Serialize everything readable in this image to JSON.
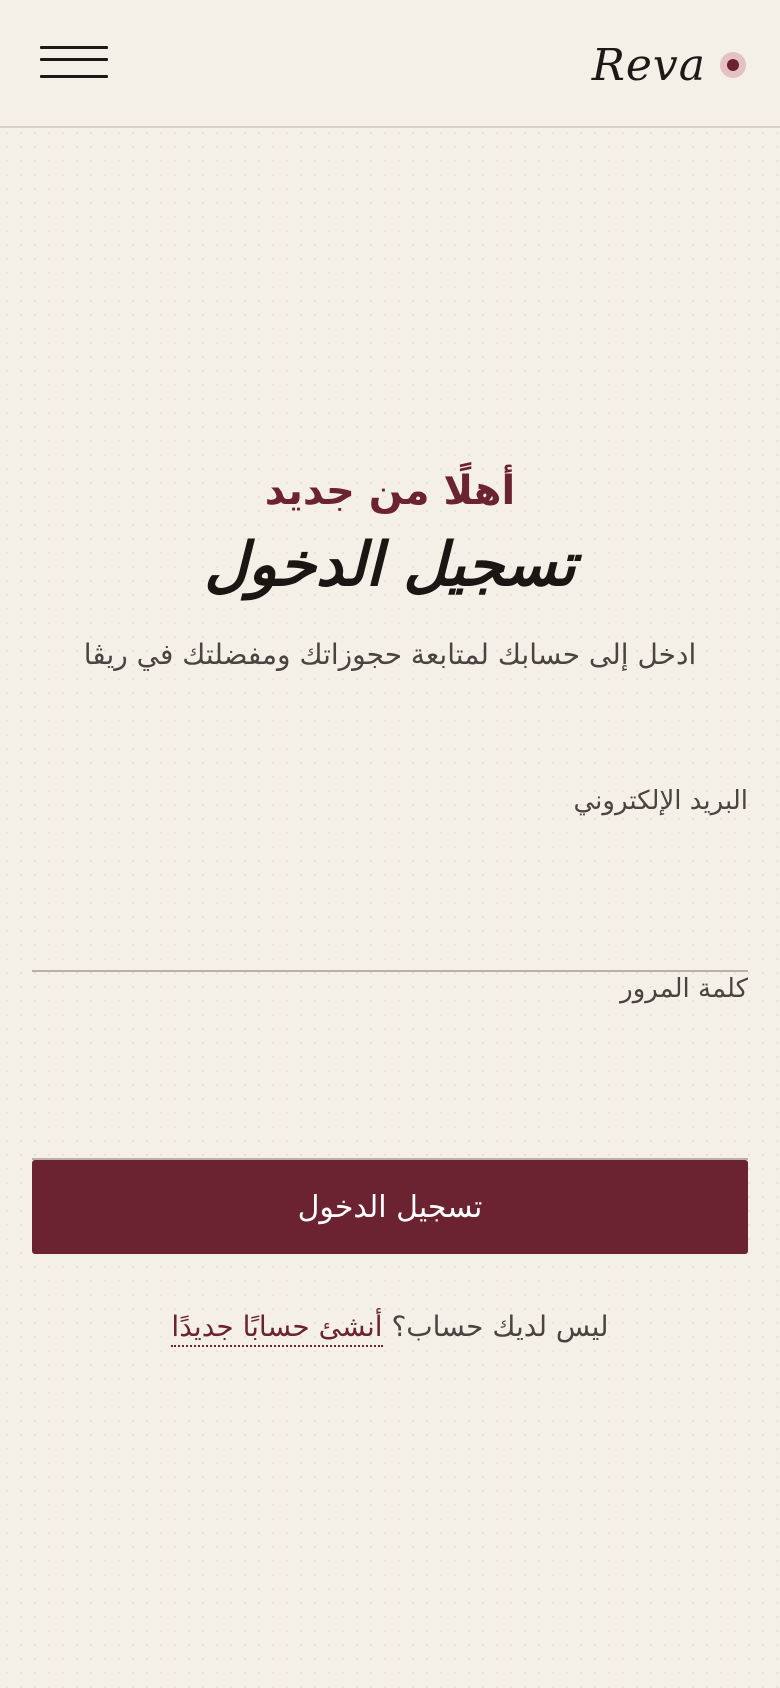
{
  "header": {
    "brand": "Reva",
    "menu_icon": "hamburger-menu-icon",
    "logo_icon": "dot-logo-icon"
  },
  "login": {
    "eyebrow": "أهلًا من جديد",
    "title": "تسجيل الدخول",
    "subtitle": "ادخل إلى حسابك لمتابعة حجوزاتك ومفضلتك في ريڤا",
    "email_label": "البريد الإلكتروني",
    "email_value": "",
    "password_label": "كلمة المرور",
    "password_value": "",
    "submit_label": "تسجيل الدخول",
    "signup_prompt": "ليس لديك حساب؟",
    "signup_link": "أنشئ حسابًا جديدًا"
  },
  "colors": {
    "background": "#f5f0e7",
    "accent": "#6b2332",
    "text": "#1c1917",
    "logo_dot_outer": "#e5c2c2"
  }
}
